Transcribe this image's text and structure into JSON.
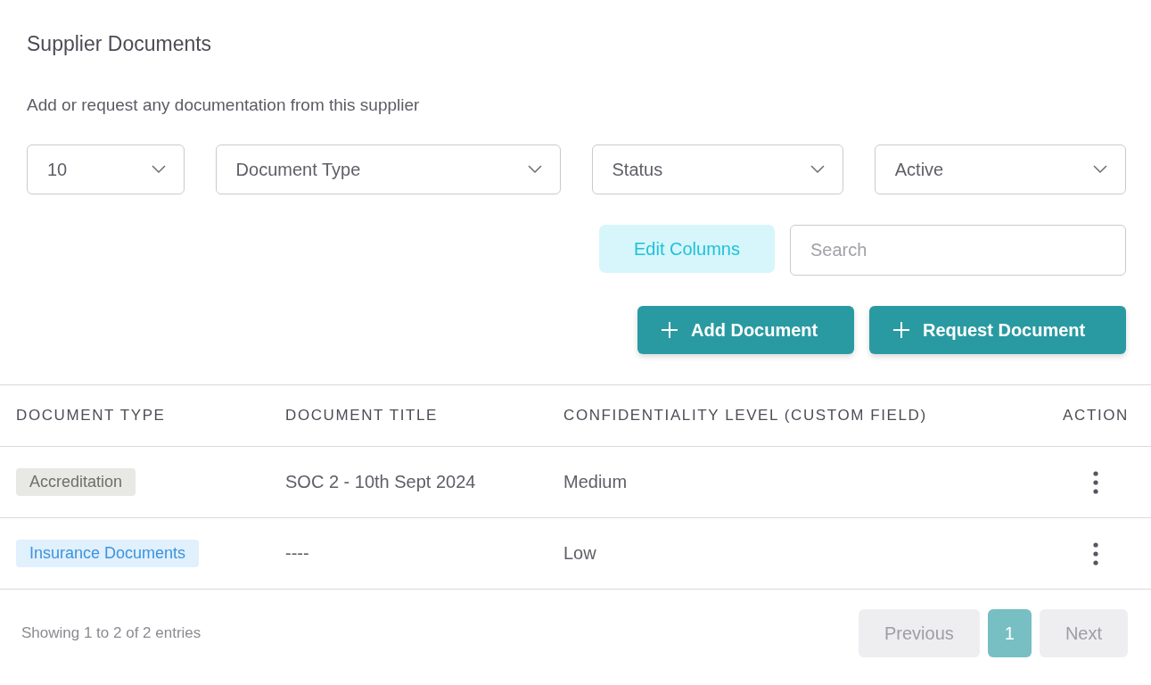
{
  "title": "Supplier Documents",
  "subtitle": "Add or request any documentation from this supplier",
  "filters": [
    {
      "value": "10"
    },
    {
      "value": "Document Type"
    },
    {
      "value": "Status"
    },
    {
      "value": "Active"
    }
  ],
  "edit_columns": "Edit Columns",
  "search": {
    "placeholder": "Search"
  },
  "actions": [
    "Add Document",
    "Request Document"
  ],
  "table": {
    "columns": [
      "DOCUMENT TYPE",
      "DOCUMENT TITLE",
      "CONFIDENTIALITY LEVEL (CUSTOM FIELD)",
      "ACTION"
    ],
    "rows": [
      {
        "type": "Accreditation",
        "color": "#6f7068",
        "title": "SOC 2 - 10th Sept 2024",
        "level": "Medium"
      },
      {
        "type": "Insurance Documents",
        "color": "#3d93dc",
        "title": "----",
        "level": "Low"
      }
    ]
  },
  "footer": {
    "info": "Showing 1 to 2 of 2 entries",
    "pages": [
      {
        "label": "Previous",
        "kind": "nav",
        "disabled": true
      },
      {
        "label": "1",
        "kind": "page",
        "selected": true
      },
      {
        "label": "Next",
        "kind": "nav",
        "disabled": true
      }
    ]
  }
}
